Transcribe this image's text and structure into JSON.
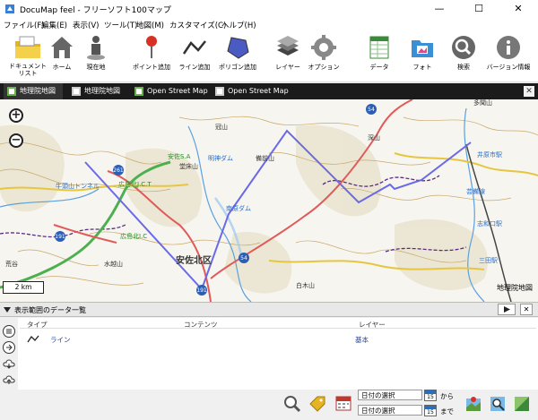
{
  "window": {
    "title": "DocuMap feel - フリーソフト100マップ",
    "minimize": "—",
    "maximize": "☐",
    "close": "✕"
  },
  "menu": [
    "ファイル(F)",
    "編集(E)",
    "表示(V)",
    "ツール(T)",
    "地図(M)",
    "カスタマイズ(C)",
    "ヘルプ(H)"
  ],
  "toolbar": {
    "doc_list": "ドキュメント\nリスト",
    "home": "ホーム",
    "current": "現在地",
    "add_point": "ポイント追加",
    "add_line": "ライン追加",
    "add_polygon": "ポリゴン追加",
    "layer": "レイヤー",
    "option": "オプション",
    "data": "データ",
    "photo": "フォト",
    "search": "検索",
    "version": "バージョン情報"
  },
  "tabs": [
    "地理院地図",
    "地理院地図",
    "Open Street Map",
    "Open Street Map"
  ],
  "map": {
    "scale": "2 km",
    "attribution": "地理院地図",
    "labels": [
      {
        "text": "安佐北区",
        "big": true
      },
      {
        "text": "広島北J.C.T"
      },
      {
        "text": "広島北I.C"
      },
      {
        "text": "安佐S.A"
      },
      {
        "text": "堂床山"
      },
      {
        "text": "明神ダム"
      },
      {
        "text": "南原ダム"
      },
      {
        "text": "備前山"
      },
      {
        "text": "白木山"
      },
      {
        "text": "多聞山"
      },
      {
        "text": "井原市駅"
      },
      {
        "text": "志和口駅"
      },
      {
        "text": "三田駅"
      },
      {
        "text": "水越山"
      },
      {
        "text": "牛頭山トンネル"
      },
      {
        "text": "荒谷"
      },
      {
        "text": "冠山"
      },
      {
        "text": "芸備線"
      },
      {
        "text": "深山"
      }
    ],
    "shields": [
      "261",
      "54",
      "191",
      "54",
      "191"
    ]
  },
  "panel": {
    "title": "表示範囲のデータ一覧",
    "columns": [
      "タイプ",
      "コンテンツ",
      "レイヤー"
    ],
    "rows": [
      {
        "type_icon": "line-icon",
        "content": "ライン",
        "layer": "基本"
      }
    ]
  },
  "footer": {
    "date_from": "日付の選択",
    "date_to": "日付の選択",
    "from_label": "から",
    "to_label": "まで",
    "cal_day": "15"
  }
}
